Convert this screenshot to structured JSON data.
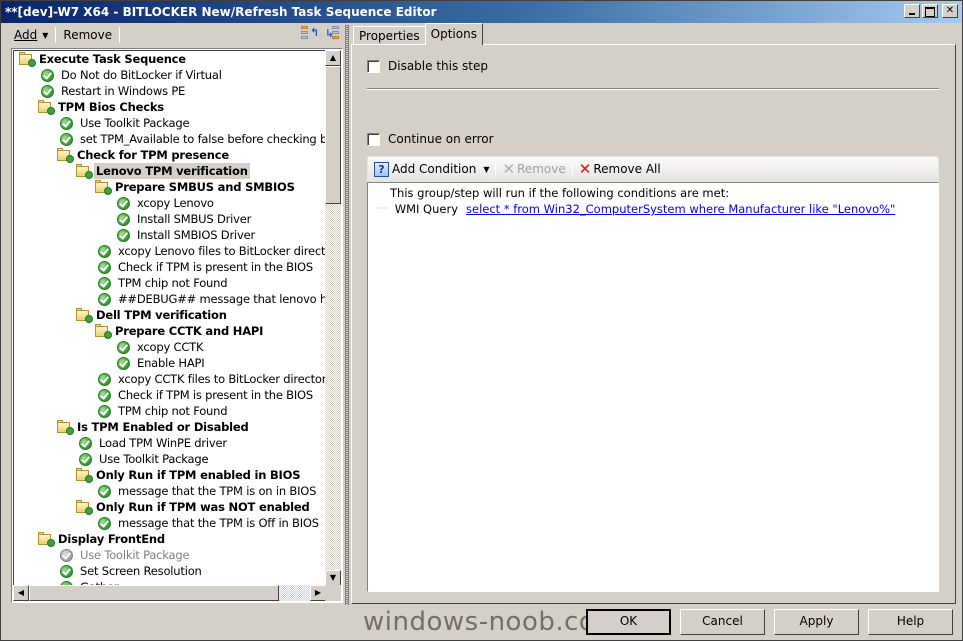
{
  "window": {
    "title": "**[dev]-W7 X64 - BITLOCKER New/Refresh Task Sequence Editor",
    "controls": [
      "minimize",
      "maximize",
      "close"
    ]
  },
  "toolbar": {
    "add_label": "Add",
    "remove_label": "Remove",
    "move_up_icon": "move-up-icon",
    "move_down_icon": "move-down-icon"
  },
  "tree": {
    "items": [
      {
        "label": "Execute Task Sequence",
        "level": 0,
        "type": "group"
      },
      {
        "label": "Do Not do BitLocker if Virtual",
        "level": 1,
        "type": "step"
      },
      {
        "label": "Restart in Windows PE",
        "level": 1,
        "type": "step"
      },
      {
        "label": "TPM Bios Checks",
        "level": 1,
        "type": "group"
      },
      {
        "label": "Use Toolkit Package",
        "level": 2,
        "type": "step"
      },
      {
        "label": "set TPM_Available to false before checking bios...",
        "level": 2,
        "type": "step"
      },
      {
        "label": "Check for TPM presence",
        "level": 2,
        "type": "group"
      },
      {
        "label": "Lenovo TPM verification",
        "level": 3,
        "type": "group",
        "selected": true
      },
      {
        "label": "Prepare SMBUS and SMBIOS",
        "level": 4,
        "type": "group"
      },
      {
        "label": "xcopy Lenovo",
        "level": 5,
        "type": "step"
      },
      {
        "label": "Install SMBUS Driver",
        "level": 5,
        "type": "step"
      },
      {
        "label": "Install SMBIOS Driver",
        "level": 5,
        "type": "step"
      },
      {
        "label": "xcopy Lenovo files to BitLocker directory",
        "level": 4,
        "type": "step"
      },
      {
        "label": "Check if TPM is present in the BIOS",
        "level": 4,
        "type": "step"
      },
      {
        "label": "TPM chip not Found",
        "level": 4,
        "type": "step"
      },
      {
        "label": "##DEBUG## message that lenovo hardware",
        "level": 4,
        "type": "step"
      },
      {
        "label": "Dell TPM verification",
        "level": 3,
        "type": "group"
      },
      {
        "label": "Prepare CCTK and HAPI",
        "level": 4,
        "type": "group"
      },
      {
        "label": "xcopy CCTK",
        "level": 5,
        "type": "step"
      },
      {
        "label": "Enable HAPI",
        "level": 5,
        "type": "step"
      },
      {
        "label": "xcopy CCTK files to BitLocker directory",
        "level": 4,
        "type": "step"
      },
      {
        "label": "Check if TPM is present in the BIOS",
        "level": 4,
        "type": "step"
      },
      {
        "label": "TPM chip not Found",
        "level": 4,
        "type": "step"
      },
      {
        "label": "Is TPM Enabled or Disabled",
        "level": 2,
        "type": "group"
      },
      {
        "label": "Load TPM WinPE driver",
        "level": 3,
        "type": "step"
      },
      {
        "label": "Use Toolkit Package",
        "level": 3,
        "type": "step"
      },
      {
        "label": "Only Run if TPM enabled in BIOS",
        "level": 3,
        "type": "group"
      },
      {
        "label": "message that the  TPM is on in BIOS",
        "level": 4,
        "type": "step"
      },
      {
        "label": "Only Run if TPM was NOT enabled",
        "level": 3,
        "type": "group"
      },
      {
        "label": "message that the  TPM is Off in BIOS",
        "level": 4,
        "type": "step"
      },
      {
        "label": "Display FrontEnd",
        "level": 1,
        "type": "group"
      },
      {
        "label": "Use Toolkit Package",
        "level": 2,
        "type": "step",
        "disabled": true
      },
      {
        "label": "Set Screen Resolution",
        "level": 2,
        "type": "step"
      },
      {
        "label": "Gather",
        "level": 2,
        "type": "step"
      }
    ]
  },
  "tabs": [
    {
      "label": "Properties",
      "active": false
    },
    {
      "label": "Options",
      "active": true
    }
  ],
  "options": {
    "disable_step_label": "Disable this step",
    "disable_step_checked": false,
    "continue_on_error_label": "Continue on error",
    "continue_on_error_checked": false,
    "add_condition_label": "Add Condition",
    "remove_label": "Remove",
    "remove_all_label": "Remove All",
    "conditions_header": "This group/step will run if the following conditions are met:",
    "conditions": [
      {
        "type": "WMI Query",
        "value": "select *  from Win32_ComputerSystem where Manufacturer like \"Lenovo%\""
      }
    ]
  },
  "buttons": {
    "ok": "OK",
    "cancel": "Cancel",
    "apply": "Apply",
    "help": "Help"
  },
  "watermark": "windows-noob.com"
}
